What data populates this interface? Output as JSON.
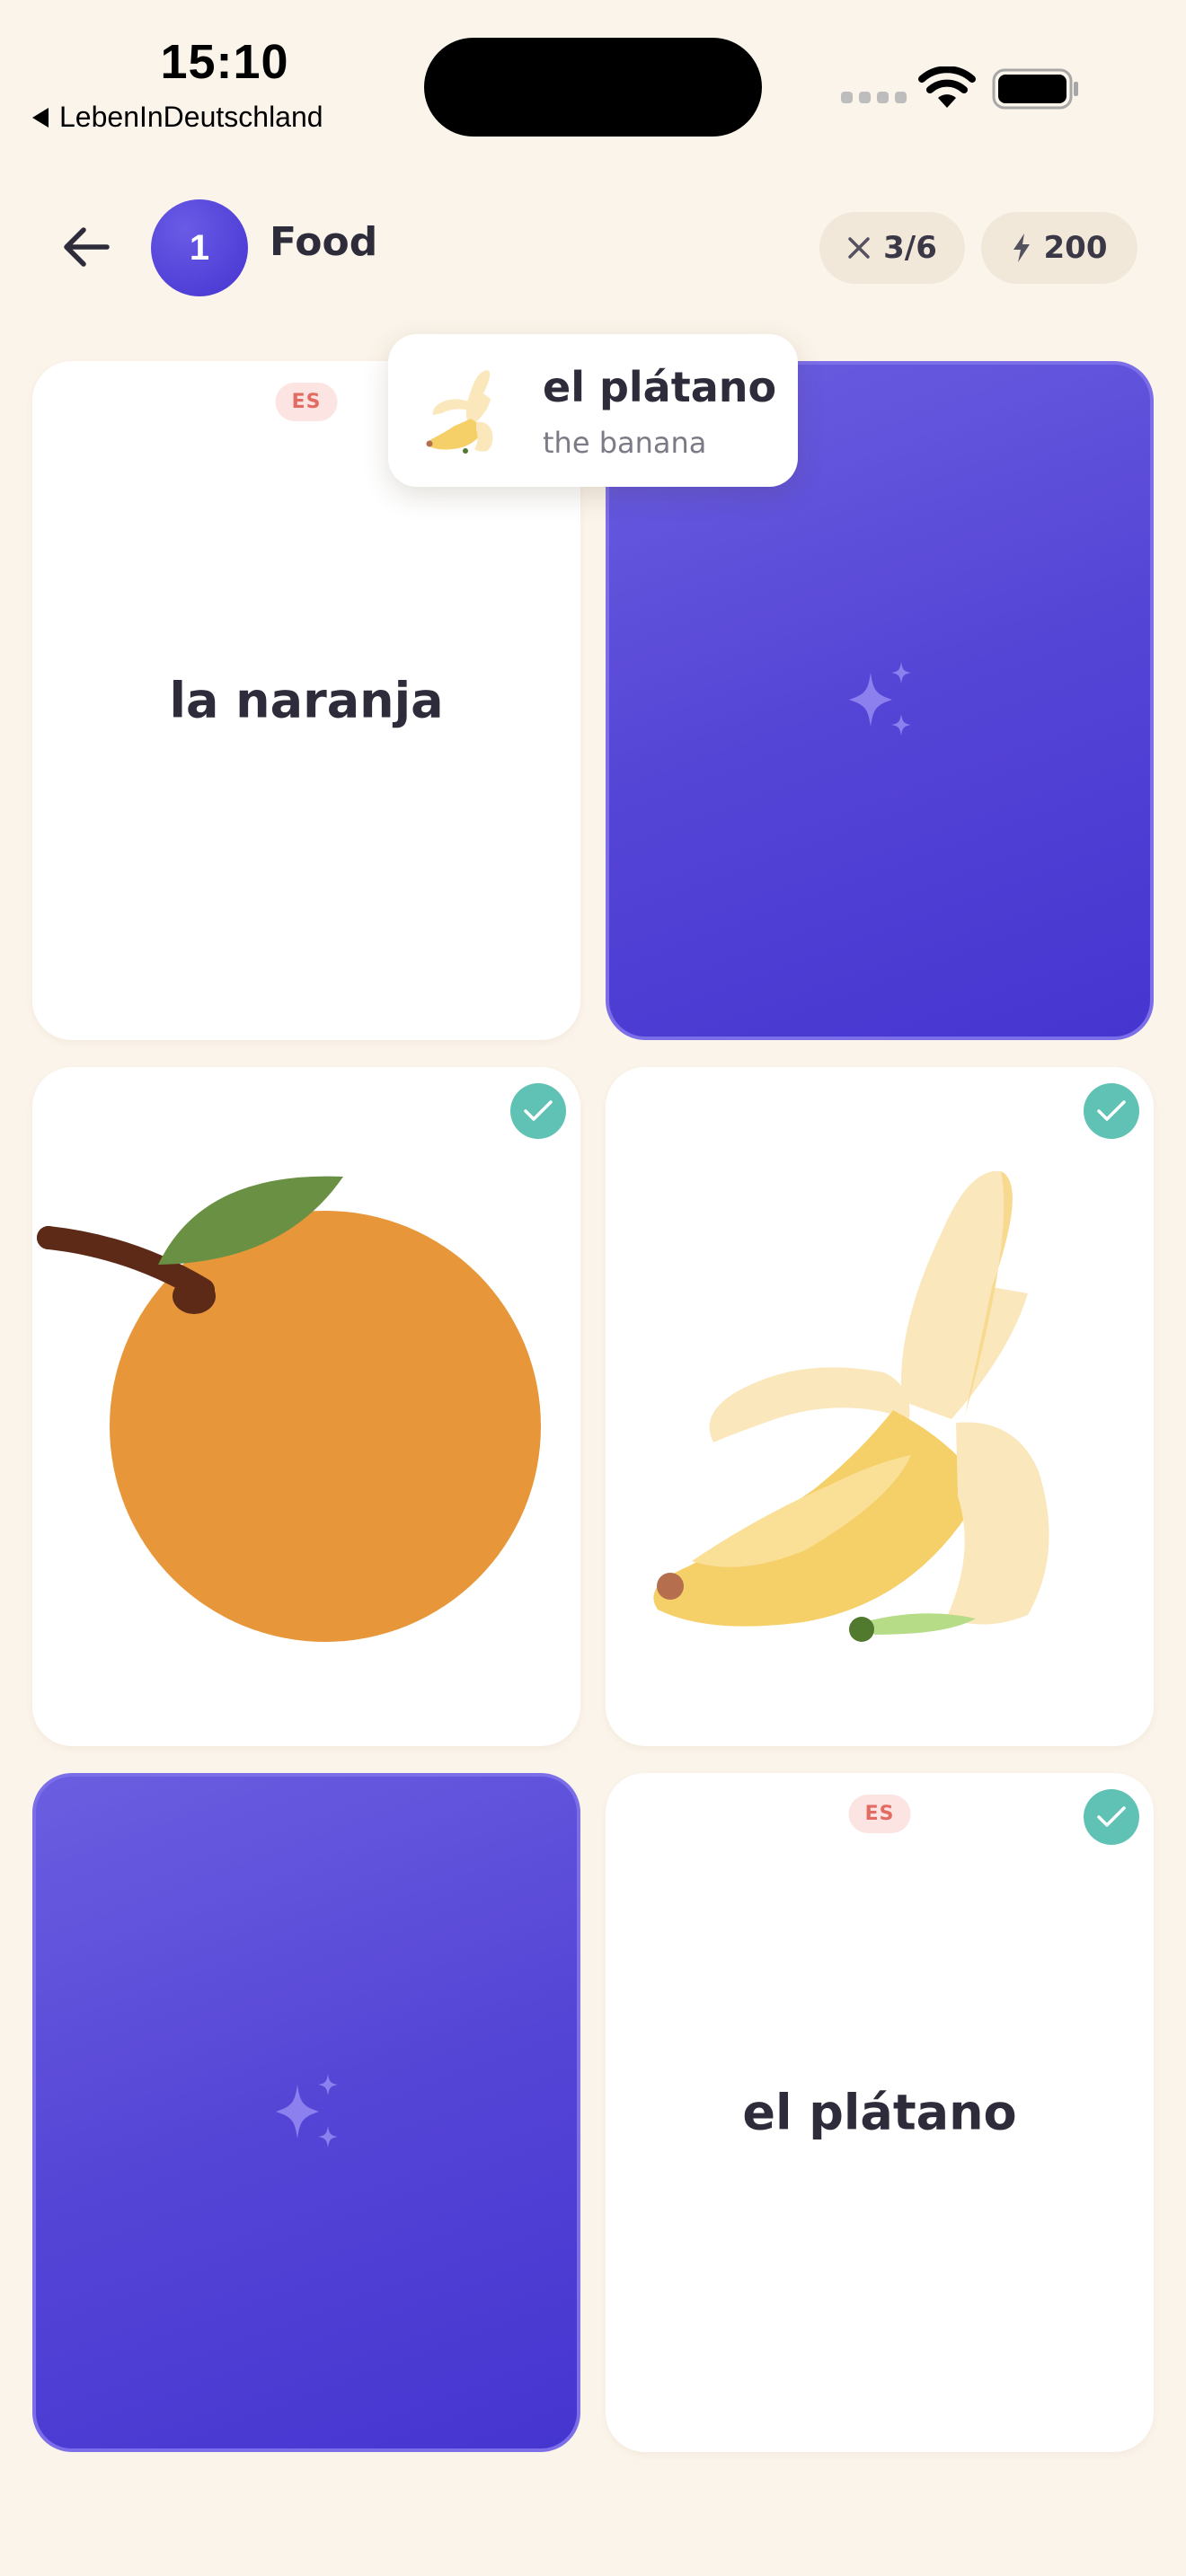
{
  "status_bar": {
    "time": "15:10",
    "back_app": "LebenInDeutschland"
  },
  "header": {
    "back_icon": "arrow-left-icon",
    "level": "1",
    "topic": "Food",
    "errors_icon": "close-x-icon",
    "errors": "3/6",
    "xp_icon": "lightning-icon",
    "xp": "200"
  },
  "cards": [
    {
      "state": "face-up",
      "kind": "word",
      "lang": "ES",
      "text": "la naranja",
      "matched": false
    },
    {
      "state": "face-down",
      "icon": "sparkles-icon"
    },
    {
      "state": "face-up",
      "kind": "image",
      "image": "orange-illustration",
      "matched": true
    },
    {
      "state": "face-up",
      "kind": "image",
      "image": "banana-illustration",
      "matched": true
    },
    {
      "state": "face-down",
      "icon": "sparkles-icon"
    },
    {
      "state": "face-up",
      "kind": "word",
      "lang": "ES",
      "text": "el plátano",
      "matched": true
    }
  ],
  "toast": {
    "icon": "banana-icon",
    "word": "el plátano",
    "translation": "the banana"
  },
  "colors": {
    "background": "#FBF4EA",
    "accent": "#5545D6",
    "success": "#5FC2B4",
    "lang_tag": "#E26B63"
  }
}
